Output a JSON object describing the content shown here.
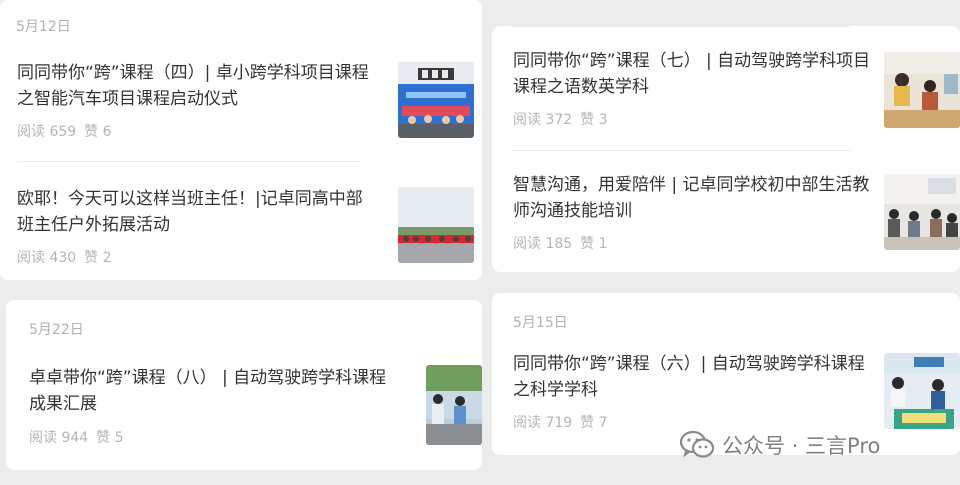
{
  "cards": {
    "top_left": {
      "date": "5月12日",
      "items": [
        {
          "title": "同同带你“跨”课程（四）| 卓小跨学科项目课程之智能汽车项目课程启动仪式",
          "reads": "阅读 659",
          "likes": "赞 6"
        },
        {
          "title": "欧耶！今天可以这样当班主任！|记卓同高中部班主任户外拓展活动",
          "reads": "阅读 430",
          "likes": "赞 2"
        }
      ]
    },
    "top_right": {
      "items": [
        {
          "title": "同同带你“跨”课程（七） | 自动驾驶跨学科项目课程之语数英学科",
          "reads": "阅读 372",
          "likes": "赞 3"
        },
        {
          "title": "智慧沟通，用爱陪伴 | 记卓同学校初中部生活教师沟通技能培训",
          "reads": "阅读 185",
          "likes": "赞 1"
        }
      ]
    },
    "bottom_left": {
      "date": "5月22日",
      "items": [
        {
          "title": "卓卓带你“跨”课程（八） | 自动驾驶跨学科课程成果汇展",
          "reads": "阅读 944",
          "likes": "赞 5"
        }
      ]
    },
    "bottom_right": {
      "date": "5月15日",
      "items": [
        {
          "title": "同同带你“跨”课程（六）| 自动驾驶跨学科课程之科学学科",
          "reads": "阅读 719",
          "likes": "赞 7"
        }
      ]
    }
  },
  "watermark": {
    "text": "公众号 · 三言Pro",
    "icon": "wechat-icon"
  }
}
